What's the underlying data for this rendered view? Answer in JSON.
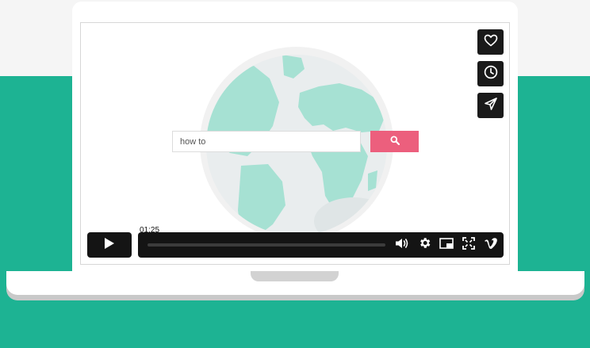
{
  "search": {
    "value": "how to"
  },
  "player": {
    "time_tooltip": "01:25",
    "progress_fraction": 0.0
  },
  "icons": {
    "like": "heart-icon",
    "watch_later": "clock-icon",
    "share": "paper-plane-icon",
    "search": "search-icon",
    "play": "play-icon",
    "volume": "volume-icon",
    "settings": "gear-icon",
    "pip": "picture-in-picture-icon",
    "fullscreen": "fullscreen-icon",
    "brand": "vimeo-icon"
  },
  "colors": {
    "background_green": "#1db393",
    "search_button": "#ec5f7d",
    "globe_land": "#a6e1d3",
    "player_dark": "#141414"
  }
}
